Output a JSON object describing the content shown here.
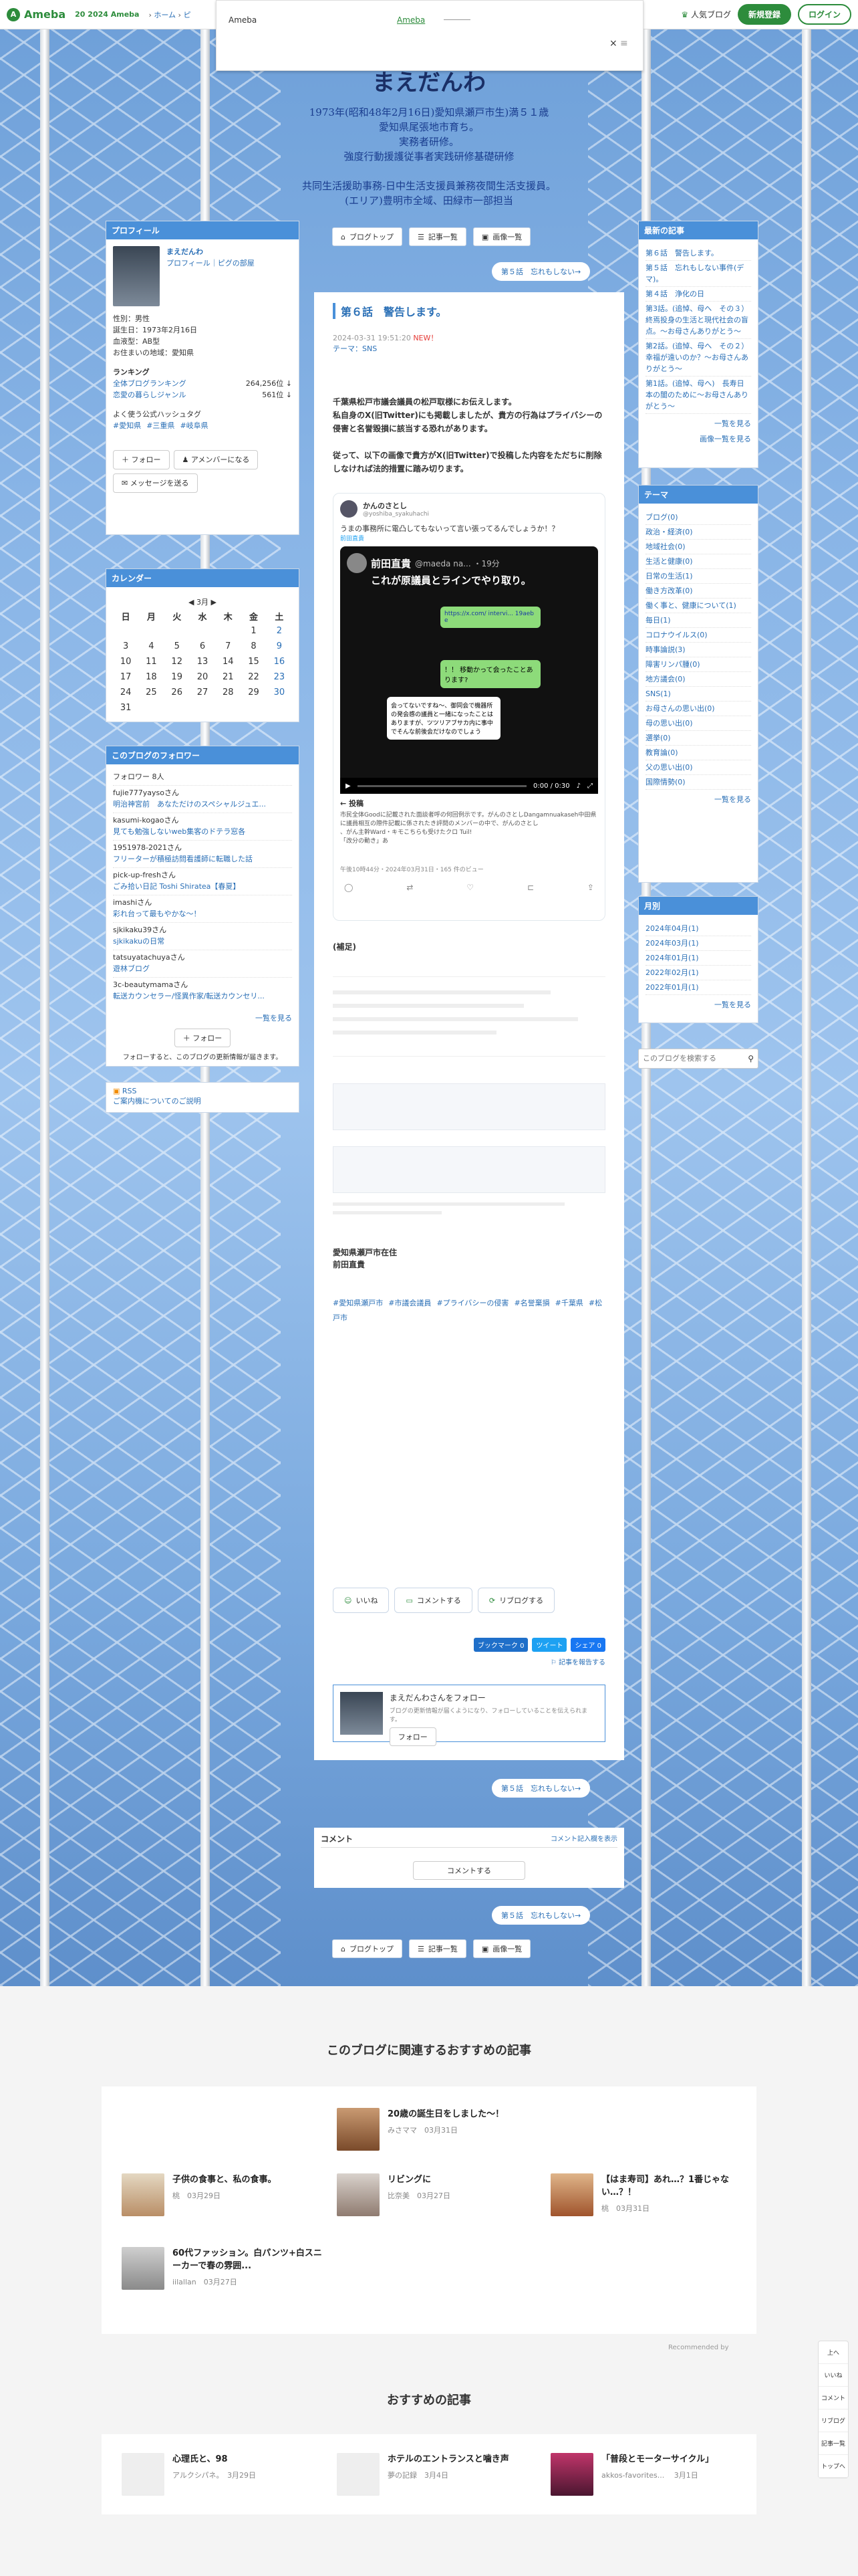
{
  "topbar": {
    "logo": "Ameba",
    "anniv": "20 2024 Ameba",
    "crumbs": [
      "ホーム",
      "ピ"
    ],
    "popular": "人気ブログ",
    "signup": "新規登録",
    "login": "ログイン"
  },
  "ad": {
    "label": "Ameba",
    "link": "Ameba",
    "close": "×"
  },
  "header": {
    "title": "まえだんわ",
    "lines": [
      "1973年(昭和48年2月16日)愛知県瀬戸市生)満５１歳",
      "愛知県尾張地市育ち。",
      "実務者研修。",
      "強度行動援護従事者実践研修基礎研修",
      "",
      "共同生活援助事務-日中生活支援員兼務夜間生活支援員。",
      "(エリア)豊明市全域、田緑市一部担当"
    ]
  },
  "nav": {
    "top": "ブログトップ",
    "list": "記事一覧",
    "images": "画像一覧",
    "prevnext": "第５話　忘れもしない→"
  },
  "profile": {
    "heading": "プロフィール",
    "name": "まえだんわ",
    "sub": "プロフィール｜ピグの部屋",
    "details": [
      "性別：男性",
      "誕生日：1973年2月16日",
      "血液型：AB型",
      "お住まいの地域：愛知県"
    ],
    "ranking_h": "ランキング",
    "rank1": "全体ブログランキング",
    "rank1v": "264,256位 ↓",
    "rank2": "恋愛の暮らしジャンル",
    "rank2v": "561位 ↓",
    "tags_h": "よく使う公式ハッシュタグ",
    "tags": [
      "#愛知県",
      "#三重県",
      "#岐阜県"
    ],
    "follow": "フォロー",
    "member": "アメンバーになる",
    "message": "メッセージを送る"
  },
  "calendar": {
    "heading": "カレンダー",
    "month": "3月",
    "days": [
      "日",
      "月",
      "火",
      "水",
      "木",
      "金",
      "土"
    ],
    "rows": [
      [
        "",
        "",
        "",
        "",
        "",
        "1",
        "2"
      ],
      [
        "3",
        "4",
        "5",
        "6",
        "7",
        "8",
        "9"
      ],
      [
        "10",
        "11",
        "12",
        "13",
        "14",
        "15",
        "16"
      ],
      [
        "17",
        "18",
        "19",
        "20",
        "21",
        "22",
        "23"
      ],
      [
        "24",
        "25",
        "26",
        "27",
        "28",
        "29",
        "30"
      ],
      [
        "31",
        "",
        "",
        "",
        "",
        "",
        ""
      ]
    ]
  },
  "followers": {
    "heading": "このブログのフォロワー",
    "count": "フォロワー 8人",
    "items": [
      [
        "fujie777yaysoさん",
        "明治神宮前　あなただけのスペシャルジュエ..."
      ],
      [
        "kasumi-kogaoさん",
        "見ても勉強しないweb集客のドテラ窓各"
      ],
      [
        "1951978-2021さん",
        "フリーターが積極訪問看護師に転職した話"
      ],
      [
        "pick-up-freshさん",
        "ごみ拾い日記 Toshi Shiratea【春夏】"
      ],
      [
        "imashiさん",
        "彩れ台って最もやかな～！"
      ],
      [
        "sjkikaku39さん",
        "sjkikakuの日常"
      ],
      [
        "tatsuyatachuyaさん",
        "遊林ブログ"
      ],
      [
        "3c-beautymamaさん",
        "転送カウンセラー/怪異作家/転送カウンセリ..."
      ]
    ],
    "more": "一覧を見る",
    "follow": "フォロー",
    "note": "フォローすると、このブログの更新情報が届きます。",
    "rss": "RSS",
    "rss2": "ご案内機についてのご説明"
  },
  "latest": {
    "heading": "最新の記事",
    "items": [
      "第６話　警告します。",
      "第５話　忘れもしない事件(デマ)。",
      "第４話　浄化の日",
      "第3話。(追悼、母へ　その３）終焉投身の生活と現代社会の盲点。〜お母さんありがとう〜",
      "第2話。(追悼、母へ　その２）幸福が遠いのか？〜お母さんありがとう〜",
      "第1話。(追悼、母へ)　長寿日本の闇のために〜お母さんありがとう〜"
    ],
    "more": "一覧を見る",
    "images": "画像一覧を見る"
  },
  "theme": {
    "heading": "テーマ",
    "items": [
      "ブログ(0)",
      "政治・経済(0)",
      "地域社会(0)",
      "生活と健康(0)",
      "日常の生活(1)",
      "働き方改革(0)",
      "働く事と、健康について(1)",
      "毎日(1)",
      "コロナウイルス(0)",
      "時事論説(3)",
      "障害リンパ腫(0)",
      "地方議会(0)",
      "SNS(1)",
      "お母さんの思い出(0)",
      "母の思い出(0)",
      "選挙(0)",
      "教育論(0)",
      "父の思い出(0)",
      "国際情勢(0)"
    ],
    "more": "一覧を見る"
  },
  "monthly": {
    "heading": "月別",
    "items": [
      "2024年04月(1)",
      "2024年03月(1)",
      "2024年01月(1)",
      "2022年02月(1)",
      "2022年01月(1)"
    ],
    "more": "一覧を見る"
  },
  "search": {
    "placeholder": "このブログを検索する"
  },
  "article": {
    "title": "第６話　警告します。",
    "date": "2024-03-31 19:51:20",
    "new": "NEW！",
    "theme": "テーマ：SNS",
    "p1": "千葉県松戸市議会議員の松戸取様にお伝えします。",
    "p2": "私自身のX(旧Twitter)にも掲載しましたが、貴方の行為はプライバシーの侵害と名誉毀損に該当する恐れがあります。",
    "p3": "従って、以下の画像で貴方がX(旧Twitter)で投稿した内容をただちに削除しなければ法的措置に踏み切ります。",
    "tw_name": "かんのさとし",
    "tw_handle": "@yoshiba_syakuhachi",
    "tw_text": "うまの事務所に電凸してもないって言い張ってるんでしょうか！？",
    "tw_link": "前田直貴",
    "vid_name": "前田直貴",
    "vid_handle": "@maeda na... ・19分",
    "vid_text": "これが原議員とラインでやり取り。",
    "chat1": "https://x.com/ intervi... 19aebe",
    "chat2": "！！ 移動かって会ったことあります?",
    "chat3": "会ってないですね〜、御同会で機器所の発会感の議員と一緒になったことはありますが、ツツリアブサカ内に事中でそんな前後会だけなのでしょう",
    "time": "0:00 / 0:30",
    "toko": "投稿",
    "quote": "市民全体Goodに記載された面談者呼の何回例示です。がんのさとしDangamnuakaseh中田県に議員相互の際件記載に係されたき評問のメンバーの中で、がんのさとし\n、がん主幹Ward・キモこちらも受けたクロ Tuil!\n「改分の動き」あ",
    "reply_stat": "午後10時44分・2024年03月31日・165 件のビュー",
    "supp": "(補足)",
    "sign1": "愛知県瀬戸市在住",
    "sign2": "前田直貴",
    "hashtags": [
      "#愛知県瀬戸市",
      "#市議会議員",
      "#プライバシーの侵害",
      "#名誉棄損",
      "#千葉県",
      "#松戸市"
    ],
    "like": "いいね",
    "comment": "コメントする",
    "reblog": "リブログする",
    "bookmark": "ブックマーク 0",
    "tweet": "ツイート",
    "share": "シェア 0",
    "report": "記事を報告する",
    "follow_name": "まえだんわさんをフォロー",
    "follow_note": "ブログの更新情報が届くようになり、フォローしていることを伝えられます。",
    "follow_btn": "フォロー"
  },
  "comment": {
    "heading": "コメント",
    "note": "コメント記入欄を表示",
    "btn": "コメントする"
  },
  "related": {
    "heading": "このブログに関連するおすすめの記事",
    "items": [
      [
        "20歳の誕生日をしました～！",
        "みさママ",
        "03月31日"
      ],
      [
        "子供の食事と、私の食事。",
        "桃",
        "03月29日"
      ],
      [
        "リビングに",
        "比奈美",
        "03月27日"
      ],
      [
        "【はま寿司】あれ…？1番じゃない…？！",
        "桃",
        "03月31日"
      ],
      [
        "60代ファッション。白パンツ+白スニーカーで春の雰囲...",
        "iilallan",
        "03月27日"
      ]
    ],
    "recby": "Recommended by"
  },
  "recommend": {
    "heading": "おすすめの記事",
    "items": [
      [
        "心理氏と、98",
        "アルクシパネ。",
        "3月29日"
      ],
      [
        "ホテルのエントランスと噛き声",
        "夢の記録",
        "3月4日"
      ],
      [
        "「普段とモーターサイクル」",
        "akkos-favorites... ",
        "3月1日"
      ]
    ]
  },
  "sideicons": [
    "上へ",
    "いいね",
    "コメント",
    "リブログ",
    "記事一覧",
    "トップへ"
  ]
}
